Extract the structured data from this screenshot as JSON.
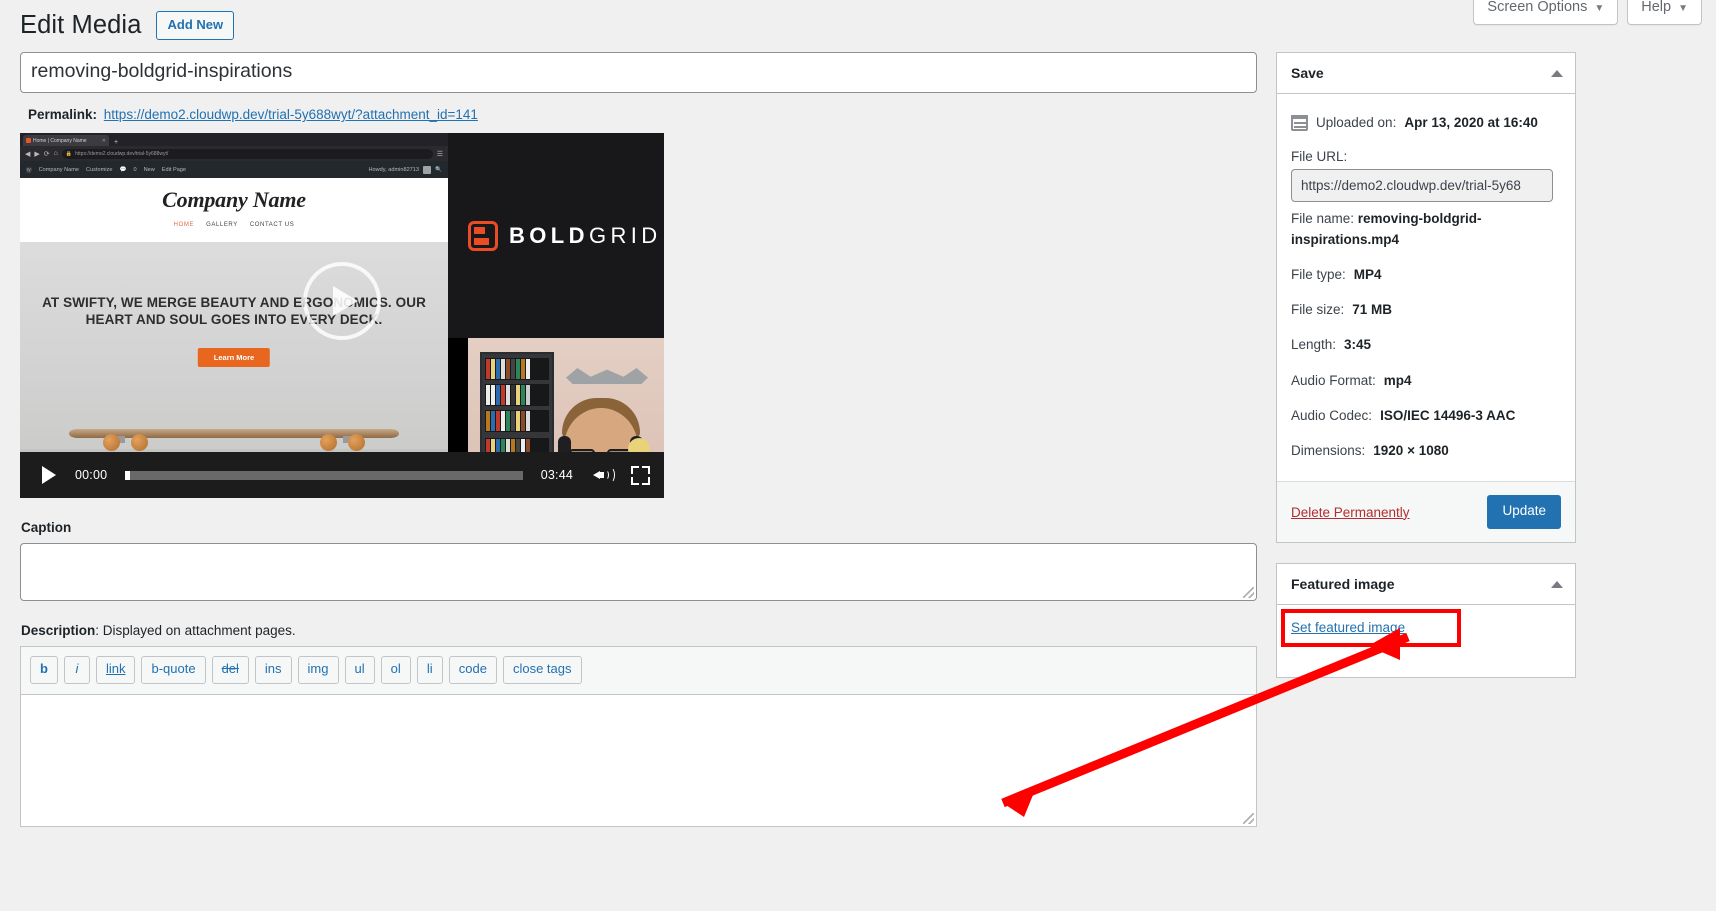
{
  "screen_meta": {
    "screen_options": "Screen Options",
    "help": "Help",
    "caret": "▼"
  },
  "header": {
    "title": "Edit Media",
    "add_new": "Add New"
  },
  "title_field": {
    "value": "removing-boldgrid-inspirations"
  },
  "permalink": {
    "label": "Permalink:",
    "url": "https://demo2.cloudwp.dev/trial-5y688wyt/?attachment_id=141"
  },
  "video": {
    "current_time": "00:00",
    "duration": "03:44",
    "capture": {
      "tab_title": "Home | Company Name",
      "tab_close": "✕",
      "tab_plus": "+",
      "url": "https://demo2.cloudwp.dev/trial-5y688wyt/",
      "lock": "🔒",
      "adminbar": {
        "site_name": "Company Name",
        "customize": "Customize",
        "comments": "0",
        "new": "New",
        "edit_page": "Edit Page",
        "howdy": "Howdy, admin82713"
      },
      "site_brand": "Company Name",
      "nav": [
        "HOME",
        "GALLERY",
        "CONTACT US"
      ],
      "hero_headline": "AT SWIFTY, WE MERGE BEAUTY AND ERGONOMICS. OUR HEART AND SOUL GOES INTO EVERY DECK.",
      "hero_button": "Learn More",
      "logo_bold": "BOLD",
      "logo_grid": "GRID"
    }
  },
  "caption": {
    "label": "Caption",
    "value": ""
  },
  "description": {
    "label": "Description",
    "hint": ": Displayed on attachment pages.",
    "value": "",
    "toolbar_buttons": [
      "b",
      "i",
      "link",
      "b-quote",
      "del",
      "ins",
      "img",
      "ul",
      "ol",
      "li",
      "code",
      "close tags"
    ]
  },
  "sidebar": {
    "save_panel": {
      "title": "Save",
      "uploaded_label": "Uploaded on:",
      "uploaded_value": "Apr 13, 2020 at 16:40",
      "file_url_label": "File URL:",
      "file_url_value": "https://demo2.cloudwp.dev/trial-5y68",
      "rows": [
        {
          "label": "File name:",
          "value": "removing-boldgrid-inspirations.mp4"
        },
        {
          "label": "File type:",
          "value": "MP4"
        },
        {
          "label": "File size:",
          "value": "71 MB"
        },
        {
          "label": "Length:",
          "value": "3:45"
        },
        {
          "label": "Audio Format:",
          "value": "mp4"
        },
        {
          "label": "Audio Codec:",
          "value": "ISO/IEC 14496-3 AAC"
        },
        {
          "label": "Dimensions:",
          "value": "1920 × 1080"
        }
      ],
      "delete_label": "Delete Permanently",
      "update_label": "Update"
    },
    "featured_panel": {
      "title": "Featured image",
      "set_featured_label": "Set featured image"
    }
  },
  "colors": {
    "accent_blue": "#2271b1",
    "delete_red": "#b32d2e",
    "annotation_red": "#ff0000",
    "boldgrid_orange": "#ea4c25",
    "page_bg": "#f0f0f1"
  }
}
